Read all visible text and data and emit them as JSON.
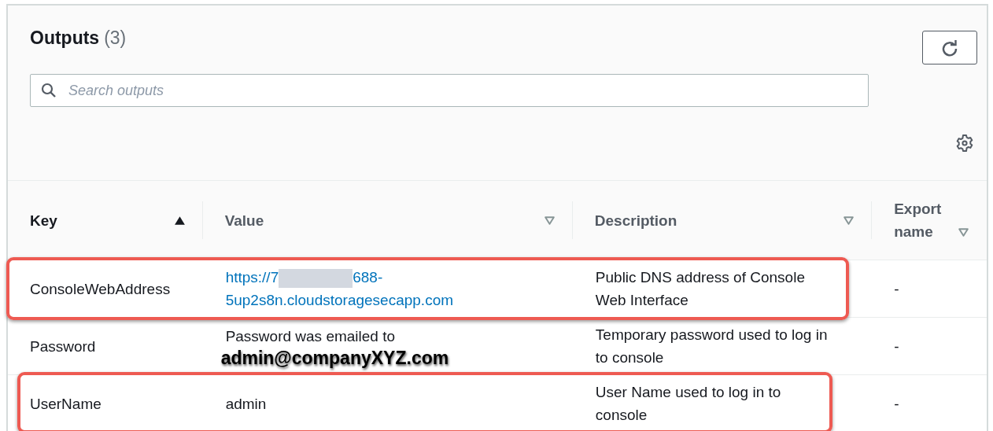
{
  "header": {
    "title": "Outputs",
    "count": "(3)"
  },
  "search": {
    "placeholder": "Search outputs"
  },
  "table": {
    "columns": [
      {
        "label": "Key",
        "sorted": true
      },
      {
        "label": "Value",
        "sorted": false
      },
      {
        "label": "Description",
        "sorted": false
      },
      {
        "label": "Export name",
        "sorted": false
      }
    ],
    "rows": [
      {
        "key": "ConsoleWebAddress",
        "value": {
          "kind": "link",
          "start": "https://7",
          "end": "688-5up2s8n.cloudstoragesecapp.com"
        },
        "description": "Public DNS address of Console Web Interface",
        "export_name": "-",
        "highlighted": true
      },
      {
        "key": "Password",
        "value": {
          "kind": "text",
          "text": "Password was emailed to"
        },
        "annotation": "admin@companyXYZ.com",
        "description": "Temporary password used to log in to console",
        "export_name": "-",
        "highlighted": false
      },
      {
        "key": "UserName",
        "value": {
          "kind": "text",
          "text": "admin"
        },
        "description": "User Name used to log in to console",
        "export_name": "-",
        "highlighted": true
      }
    ]
  }
}
